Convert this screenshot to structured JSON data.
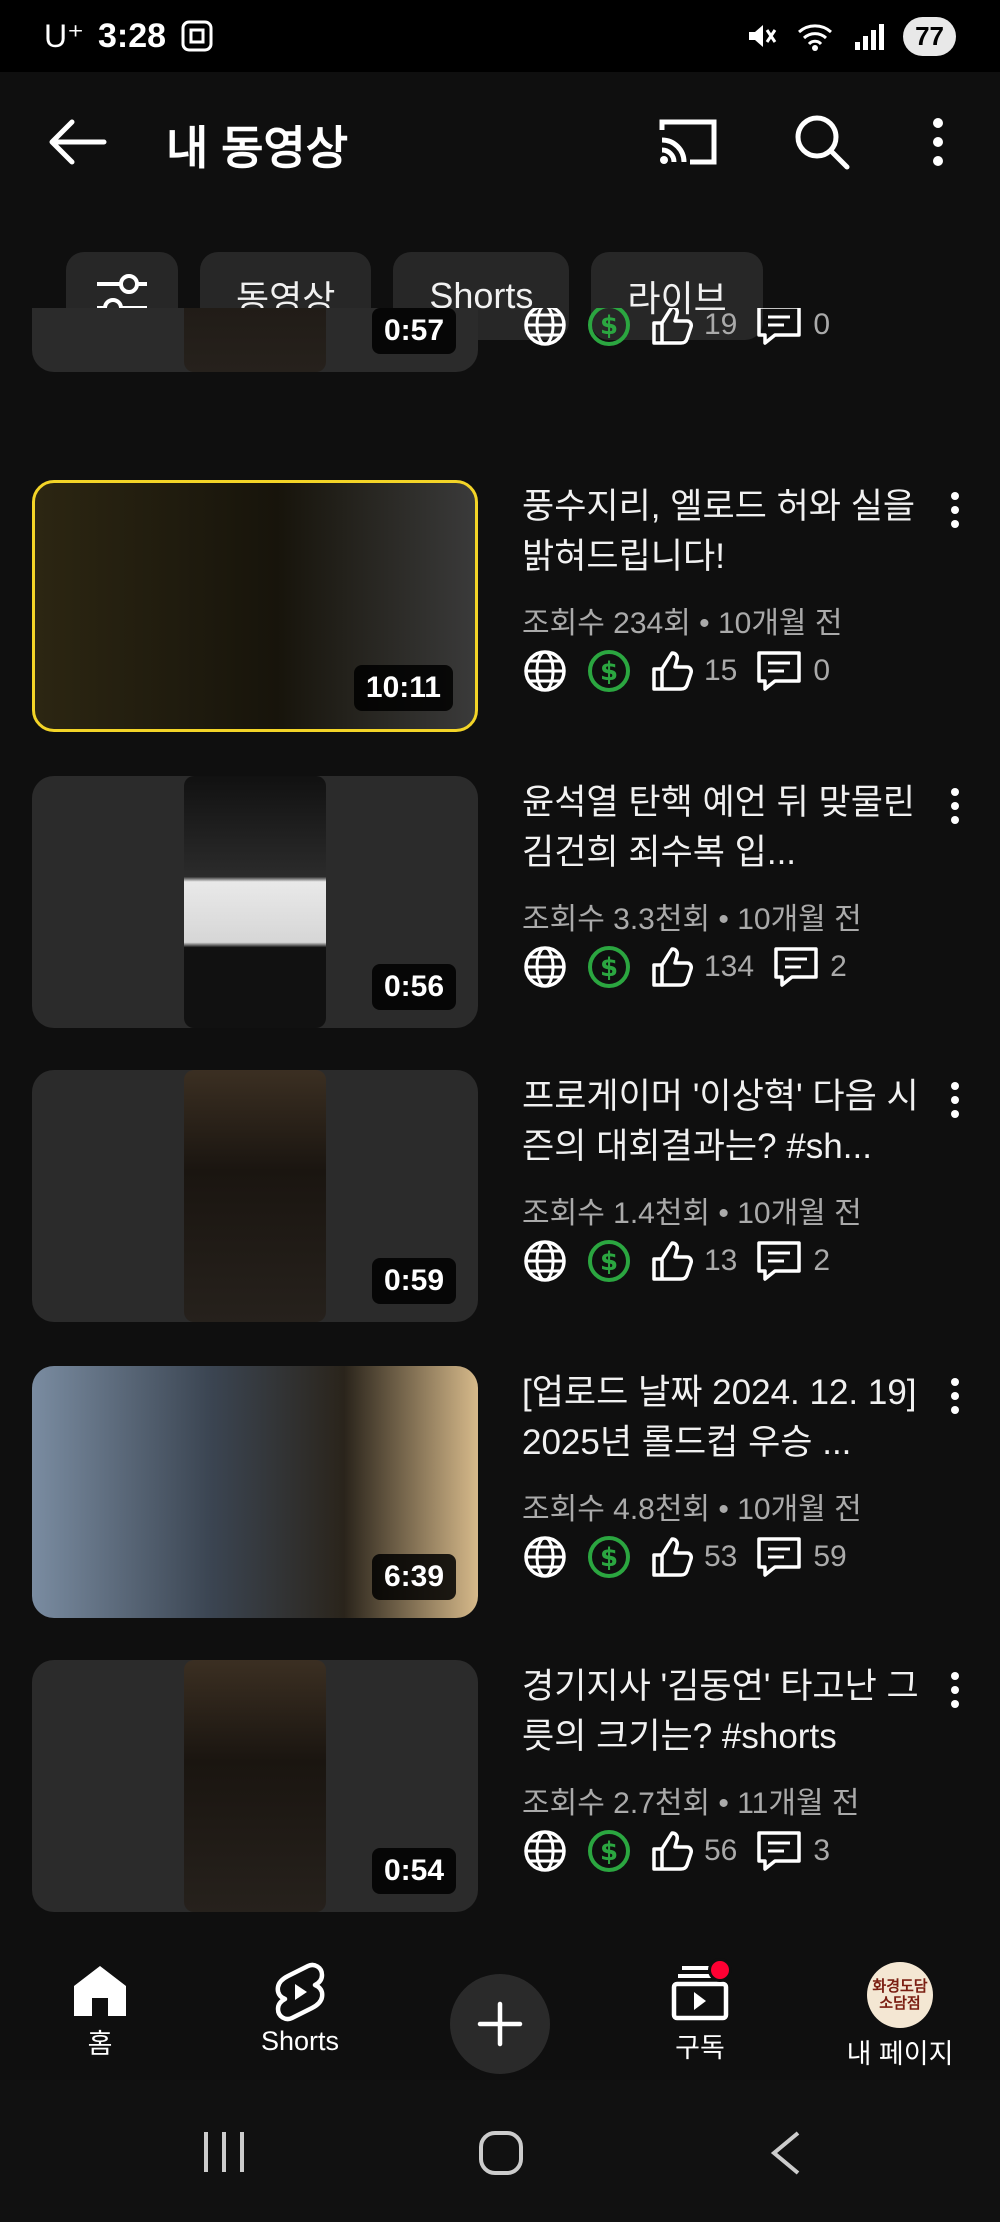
{
  "status_bar": {
    "carrier": "U⁺",
    "time": "3:28",
    "battery": "77"
  },
  "header": {
    "title": "내 동영상"
  },
  "chips": [
    "동영상",
    "Shorts",
    "라이브"
  ],
  "videos": [
    {
      "title": "",
      "meta": "",
      "duration": "0:57",
      "likes": "19",
      "comments": "0",
      "kind": "short"
    },
    {
      "title": "풍수지리, 엘로드 허와 실을 밝혀드립니다!",
      "meta": "조회수 234회 • 10개월 전",
      "duration": "10:11",
      "likes": "15",
      "comments": "0",
      "kind": "wide"
    },
    {
      "title": "윤석열 탄핵 예언 뒤 맞물린 김건희 죄수복 입...",
      "meta": "조회수 3.3천회 • 10개월 전",
      "duration": "0:56",
      "likes": "134",
      "comments": "2",
      "kind": "short"
    },
    {
      "title": "프로게이머 '이상혁' 다음 시즌의 대회결과는? #sh...",
      "meta": "조회수 1.4천회 • 10개월 전",
      "duration": "0:59",
      "likes": "13",
      "comments": "2",
      "kind": "short"
    },
    {
      "title": "[업로드 날짜 2024. 12. 19] 2025년 롤드컵 우승 ...",
      "meta": "조회수 4.8천회 • 10개월 전",
      "duration": "6:39",
      "likes": "53",
      "comments": "59",
      "kind": "wide"
    },
    {
      "title": "경기지사 '김동연' 타고난 그릇의 크기는? #shorts",
      "meta": "조회수 2.7천회 • 11개월 전",
      "duration": "0:54",
      "likes": "56",
      "comments": "3",
      "kind": "short"
    }
  ],
  "bottom_nav": {
    "home": "홈",
    "shorts": "Shorts",
    "subscriptions": "구독",
    "my_page": "내 페이지",
    "avatar_text": "화경도담 소담점"
  },
  "colors": {
    "background": "#0f0f0f",
    "monetization_green": "#2ba640",
    "notification_red": "#ff0033"
  }
}
